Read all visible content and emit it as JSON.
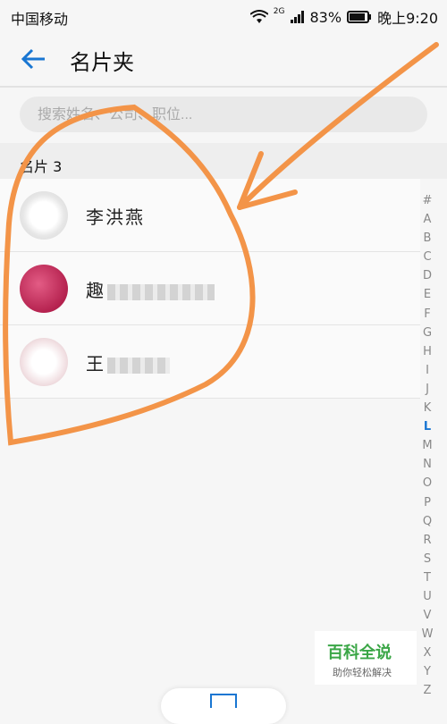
{
  "status_bar": {
    "carrier": "中国移动",
    "network": "2G",
    "battery": "83%",
    "time": "晚上9:20"
  },
  "header": {
    "back_icon": "arrow-left-icon",
    "title": "名片夹"
  },
  "search": {
    "placeholder": "搜索姓名、公司、职位..."
  },
  "section": {
    "label": "名片 3"
  },
  "cards": [
    {
      "name": "李洪燕"
    },
    {
      "name": "趣"
    },
    {
      "name": "王"
    }
  ],
  "alphabet_index": {
    "letters": [
      "#",
      "A",
      "B",
      "C",
      "D",
      "E",
      "F",
      "G",
      "H",
      "I",
      "J",
      "K",
      "L",
      "M",
      "N",
      "O",
      "P",
      "Q",
      "R",
      "S",
      "T",
      "U",
      "V",
      "W",
      "X",
      "Y",
      "Z"
    ],
    "active": "L"
  },
  "watermark": {
    "title": "百科全说",
    "subtitle": "助你轻松解决"
  },
  "colors": {
    "accent": "#1976d2",
    "annotation": "#f39448"
  }
}
